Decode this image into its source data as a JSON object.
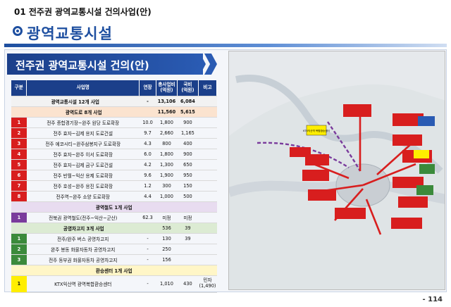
{
  "section_label": "01 전주권 광역교통시설 건의사업(안)",
  "page_title": "광역교통시설",
  "banner": "전주권 광역교통시설 건의(안)",
  "table": {
    "headers": [
      "구분",
      "사업명",
      "연장",
      "총사업비\n(억원)",
      "국비\n(억원)",
      "비고"
    ],
    "total": {
      "label": "광역교통시설 12개 사업",
      "length": "-",
      "cost": "13,106",
      "gov": "6,084"
    },
    "road_group": {
      "label": "광역도로 8개 사업",
      "cost": "11,560",
      "gov": "5,615"
    },
    "roads": [
      {
        "no": "1",
        "name": "전주 종합경기장~완주 원당 도로확장",
        "length": "10.0",
        "cost": "1,800",
        "gov": "900"
      },
      {
        "no": "2",
        "name": "전주 효자~김제 용지 도로건설",
        "length": "9.7",
        "cost": "2,660",
        "gov": "1,165"
      },
      {
        "no": "3",
        "name": "전주 에코시티~완주삼봉지구 도로확장",
        "length": "4.3",
        "cost": "800",
        "gov": "400"
      },
      {
        "no": "4",
        "name": "전주 효자~완주 이서 도로확장",
        "length": "6.0",
        "cost": "1,800",
        "gov": "900"
      },
      {
        "no": "5",
        "name": "전주 효자~김제 금구 도로건설",
        "length": "4.2",
        "cost": "1,300",
        "gov": "650"
      },
      {
        "no": "6",
        "name": "전주 반월~익산 용제 도로확장",
        "length": "9.6",
        "cost": "1,900",
        "gov": "950"
      },
      {
        "no": "7",
        "name": "전주 호성~완주 용진 도로확장",
        "length": "1.2",
        "cost": "300",
        "gov": "150"
      },
      {
        "no": "8",
        "name": "전주역~완주 소양 도로확장",
        "length": "4.4",
        "cost": "1,000",
        "gov": "500"
      }
    ],
    "rail_group": {
      "label": "광역철도 1개 사업"
    },
    "rail": {
      "no": "1",
      "name": "전북권 광역철도(전주~익산~군산)",
      "length": "62.3",
      "cost": "미정",
      "gov": "미정"
    },
    "pub_group": {
      "label": "공영차고지 3개 사업",
      "cost": "536",
      "gov": "39"
    },
    "pubs": [
      {
        "no": "1",
        "name": "전주/완주 버스 공영차고지",
        "length": "-",
        "cost": "130",
        "gov": "39"
      },
      {
        "no": "2",
        "name": "완주 봉동 화물자동차 공영차고지",
        "length": "-",
        "cost": "250",
        "gov": ""
      },
      {
        "no": "3",
        "name": "전주 동부권 화물자동차 공영차고지",
        "length": "-",
        "cost": "156",
        "gov": ""
      }
    ],
    "hub_group": {
      "label": "환승센터 1개 사업"
    },
    "hub": {
      "no": "1",
      "name": "KTX익산역 광역복합환승센터",
      "length": "-",
      "cost": "1,010",
      "gov": "430",
      "note": "민자\n(1,490)"
    }
  },
  "map_labels": {
    "ktx": "KTX익산역 복합환승센터"
  },
  "page_number": "- 114",
  "colors": {
    "primary": "#1e4fa0",
    "banner": "#1b3f8a",
    "road": "#d81e1e",
    "rail": "#7a3b9c",
    "pub": "#3b8a3b",
    "hub": "#ffee00"
  }
}
